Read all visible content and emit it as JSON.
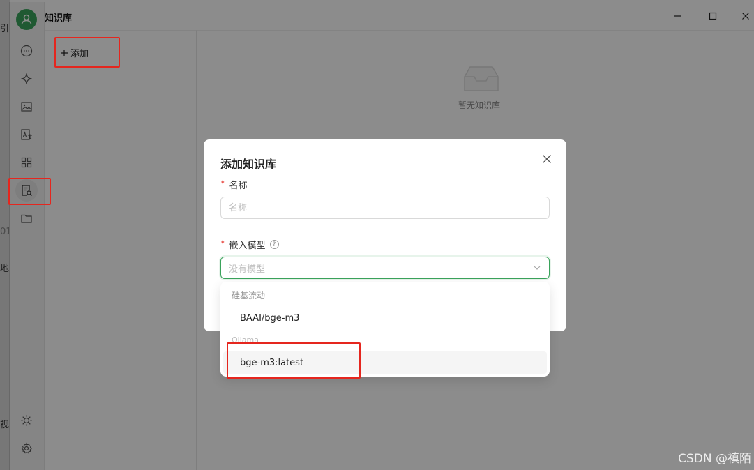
{
  "background_fragments": [
    "引",
    "01",
    "地",
    "视"
  ],
  "app": {
    "title": "知识库",
    "accent_color": "#3aa35b"
  },
  "sidebar": {
    "items": [
      {
        "icon": "chat-icon"
      },
      {
        "icon": "sparkle-icon"
      },
      {
        "icon": "image-icon"
      },
      {
        "icon": "image-translate-icon"
      },
      {
        "icon": "apps-grid-icon"
      },
      {
        "icon": "knowledge-base-icon",
        "active": true
      },
      {
        "icon": "folder-icon"
      }
    ],
    "bottom": [
      {
        "icon": "theme-sun-icon"
      },
      {
        "icon": "settings-gear-icon"
      }
    ]
  },
  "list_panel": {
    "add_label": "添加"
  },
  "main": {
    "empty_text": "暂无知识库"
  },
  "modal": {
    "title": "添加知识库",
    "name_label": "名称",
    "name_placeholder": "名称",
    "model_label": "嵌入模型",
    "model_placeholder": "没有模型"
  },
  "dropdown": {
    "groups": [
      {
        "label": "硅基流动",
        "options": [
          "BAAI/bge-m3"
        ]
      },
      {
        "label": "Ollama",
        "options": [
          "bge-m3:latest"
        ]
      }
    ]
  },
  "watermark": "CSDN @禛陌"
}
